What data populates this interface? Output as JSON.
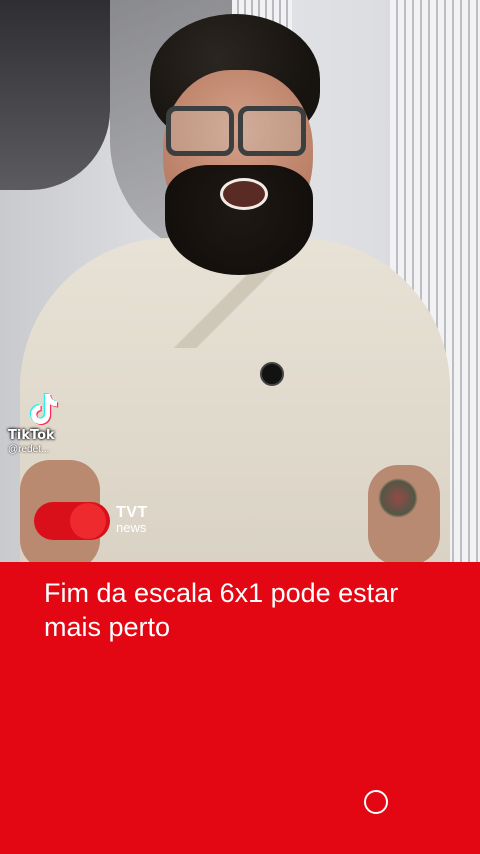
{
  "video": {
    "watermark": {
      "app_name": "TikTok",
      "handle": "@redet..."
    },
    "logo": {
      "brand": "TVT",
      "sub": "news",
      "color": "#e30613"
    }
  },
  "caption": {
    "headline": "Fim da escala 6x1 pode estar mais perto"
  },
  "colors": {
    "panel": "#e30613",
    "text": "#ffffff"
  },
  "icons": {
    "watermark": "tiktok-logo-icon",
    "control": "circle-outline-icon"
  }
}
